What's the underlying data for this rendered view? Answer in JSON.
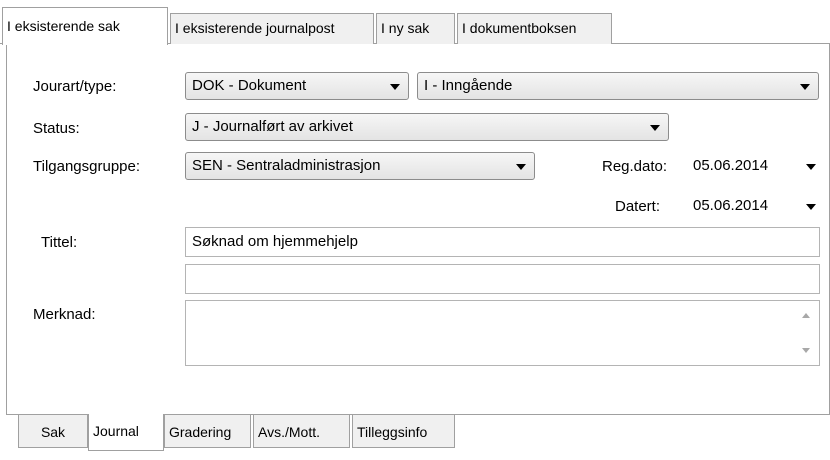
{
  "top_tabs": [
    "I eksisterende sak",
    "I eksisterende journalpost",
    "I ny sak",
    "I dokumentboksen"
  ],
  "form": {
    "jourart_label": "Jourart/type:",
    "jourart_value": "DOK - Dokument",
    "type_value": "I - Inngående",
    "status_label": "Status:",
    "status_value": "J - Journalført av arkivet",
    "tilgang_label": "Tilgangsgruppe:",
    "tilgang_value": "SEN - Sentraladministrasjon",
    "regdato_label": "Reg.dato:",
    "regdato_value": "05.06.2014",
    "datert_label": "Datert:",
    "datert_value": "05.06.2014",
    "tittel_label": "Tittel:",
    "tittel_value": "Søknad om hjemmehjelp",
    "tittel2_value": "",
    "merknad_label": "Merknad:",
    "merknad_value": ""
  },
  "bottom_tabs": [
    "Sak",
    "Journal",
    "Gradering",
    "Avs./Mott.",
    "Tilleggsinfo"
  ]
}
